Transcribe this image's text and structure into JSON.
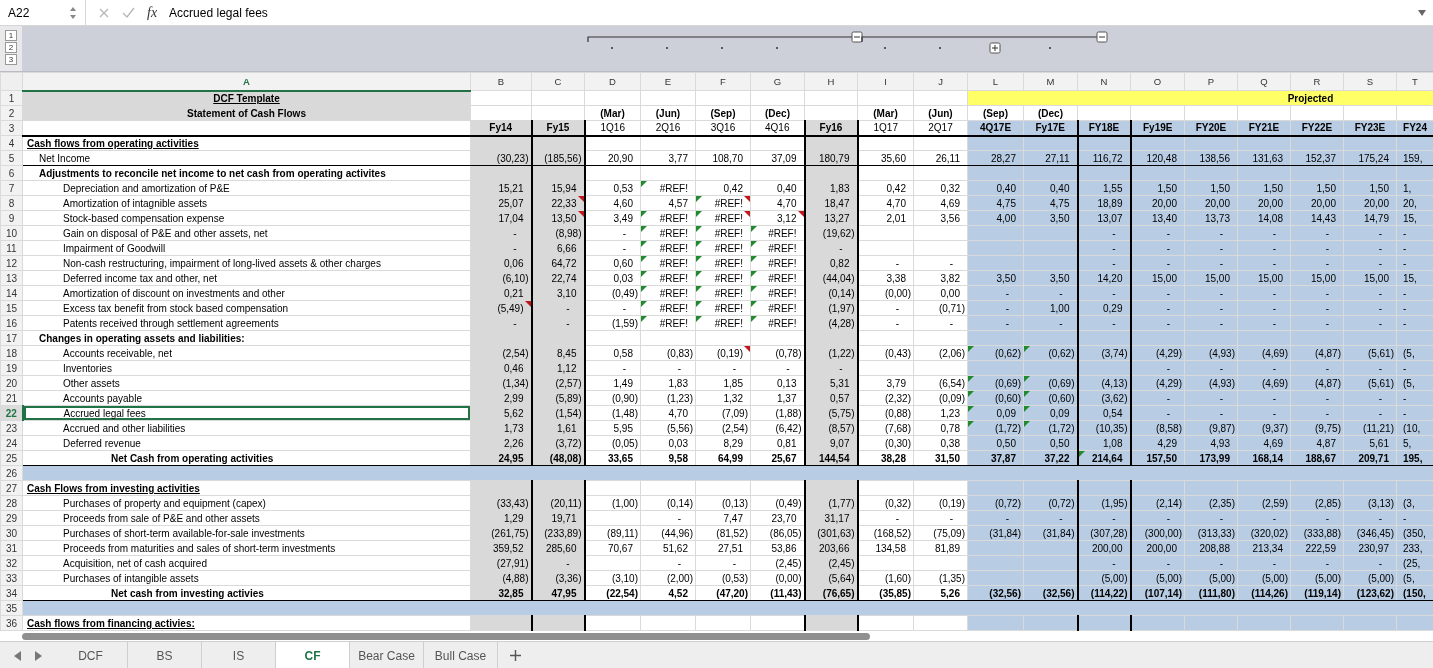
{
  "formula_bar": {
    "cell_ref": "A22",
    "function_label": "fx",
    "content": "Accrued legal fees"
  },
  "outline": {
    "levels": [
      "1",
      "2",
      "3"
    ],
    "groups": [
      {
        "expanded": true
      },
      {
        "expanded": true
      },
      {
        "expanded": false
      }
    ]
  },
  "columns": [
    {
      "letter": "A",
      "kind": "label",
      "selected": true
    },
    {
      "letter": "B",
      "kind": "actual",
      "selected": false
    },
    {
      "letter": "C",
      "kind": "actual",
      "selected": false
    },
    {
      "letter": "D",
      "kind": "quarter",
      "selected": false
    },
    {
      "letter": "E",
      "kind": "quarter",
      "selected": false
    },
    {
      "letter": "F",
      "kind": "quarter",
      "selected": false
    },
    {
      "letter": "G",
      "kind": "quarter",
      "selected": false
    },
    {
      "letter": "H",
      "kind": "actual",
      "selected": false
    },
    {
      "letter": "I",
      "kind": "quarter",
      "selected": false
    },
    {
      "letter": "J",
      "kind": "quarter",
      "selected": false
    },
    {
      "letter": "L",
      "kind": "projected",
      "selected": false
    },
    {
      "letter": "M",
      "kind": "projected",
      "selected": false
    },
    {
      "letter": "N",
      "kind": "projected",
      "selected": false
    },
    {
      "letter": "O",
      "kind": "projected",
      "selected": false
    },
    {
      "letter": "P",
      "kind": "projected",
      "selected": false
    },
    {
      "letter": "Q",
      "kind": "projected",
      "selected": false
    },
    {
      "letter": "R",
      "kind": "projected",
      "selected": false
    },
    {
      "letter": "S",
      "kind": "projected",
      "selected": false
    },
    {
      "letter": "T",
      "kind": "projected",
      "selected": false
    }
  ],
  "rows": [
    {
      "n": "1",
      "kind": "title",
      "label": "DCF Template",
      "selected": false,
      "banner": "Projected"
    },
    {
      "n": "2",
      "kind": "subtitle",
      "label": "Statement of Cash Flows",
      "selected": false,
      "cells": {
        "D": "(Mar)",
        "E": "(Jun)",
        "F": "(Sep)",
        "G": "(Dec)",
        "I": "(Mar)",
        "J": "(Jun)",
        "L": "(Sep)",
        "M": "(Dec)"
      },
      "bold": {
        "D": true,
        "E": true,
        "F": true,
        "G": true,
        "I": true,
        "J": true,
        "L": true,
        "M": true
      }
    },
    {
      "n": "3",
      "kind": "period",
      "selected": false,
      "cells": {
        "B": "Fy14",
        "C": "Fy15",
        "D": "1Q16",
        "E": "2Q16",
        "F": "3Q16",
        "G": "4Q16",
        "H": "Fy16",
        "I": "1Q17",
        "J": "2Q17",
        "L": "4Q17E",
        "M": "Fy17E",
        "N": "FY18E",
        "O": "Fy19E",
        "P": "FY20E",
        "Q": "FY21E",
        "R": "FY22E",
        "S": "FY23E",
        "T": "FY24"
      },
      "bold": {
        "B": true,
        "C": true,
        "H": true,
        "L": true,
        "M": true,
        "N": true,
        "O": true,
        "P": true,
        "Q": true,
        "R": true,
        "S": true,
        "T": true
      }
    },
    {
      "n": "4",
      "kind": "section",
      "label": "Cash flows from operating activities",
      "selected": false
    },
    {
      "n": "5",
      "kind": "item",
      "label": "Net Income",
      "selected": false,
      "cells": {
        "B": "(30,23)",
        "C": "(185,56)",
        "D": "20,90",
        "E": "3,77",
        "F": "108,70",
        "G": "37,09",
        "H": "180,79",
        "I": "35,60",
        "J": "26,11",
        "L": "28,27",
        "M": "27,11",
        "N": "116,72",
        "O": "120,48",
        "P": "138,56",
        "Q": "131,63",
        "R": "152,37",
        "S": "175,24",
        "T": "159,"
      }
    },
    {
      "n": "6",
      "kind": "heading",
      "label": "Adjustments to reconcile net income to net cash from operating activites",
      "selected": false
    },
    {
      "n": "7",
      "kind": "subitem",
      "label": "Depreciation and amortization of P&E",
      "selected": false,
      "cells": {
        "B": "15,21",
        "C": "15,94",
        "D": "0,53",
        "E": "#REF!",
        "F": "0,42",
        "G": "0,40",
        "H": "1,83",
        "I": "0,42",
        "J": "0,32",
        "L": "0,40",
        "M": "0,40",
        "N": "1,55",
        "O": "1,50",
        "P": "1,50",
        "Q": "1,50",
        "R": "1,50",
        "S": "1,50",
        "T": "1,"
      },
      "error_flags": {
        "E": true
      }
    },
    {
      "n": "8",
      "kind": "subitem",
      "label": "Amortization of intagnible assets",
      "selected": false,
      "cells": {
        "B": "25,07",
        "C": "22,33",
        "D": "4,60",
        "E": "4,57",
        "F": "#REF!",
        "G": "4,70",
        "H": "18,47",
        "I": "4,70",
        "J": "4,69",
        "L": "4,75",
        "M": "4,75",
        "N": "18,89",
        "O": "20,00",
        "P": "20,00",
        "Q": "20,00",
        "R": "20,00",
        "S": "20,00",
        "T": "20,"
      },
      "error_flags": {
        "F": true
      },
      "comment_flags": {
        "C": true,
        "F": true
      }
    },
    {
      "n": "9",
      "kind": "subitem",
      "label": "Stock-based compensation expense",
      "selected": false,
      "cells": {
        "B": "17,04",
        "C": "13,50",
        "D": "3,49",
        "E": "#REF!",
        "F": "#REF!",
        "G": "3,12",
        "H": "13,27",
        "I": "2,01",
        "J": "3,56",
        "L": "4,00",
        "M": "3,50",
        "N": "13,07",
        "O": "13,40",
        "P": "13,73",
        "Q": "14,08",
        "R": "14,43",
        "S": "14,79",
        "T": "15,"
      },
      "error_flags": {
        "E": true,
        "F": true
      },
      "comment_flags": {
        "C": true,
        "F": true,
        "G": true
      }
    },
    {
      "n": "10",
      "kind": "subitem",
      "label": "Gain on disposal of P&E and other assets, net",
      "selected": false,
      "cells": {
        "B": "-",
        "C": "(8,98)",
        "D": "-",
        "E": "#REF!",
        "F": "#REF!",
        "G": "#REF!",
        "H": "(19,62)",
        "N": "-",
        "O": "-",
        "P": "-",
        "Q": "-",
        "R": "-",
        "S": "-",
        "T": "-"
      },
      "error_flags": {
        "E": true,
        "F": true,
        "G": true
      }
    },
    {
      "n": "11",
      "kind": "subitem",
      "label": "Impairment of Goodwill",
      "selected": false,
      "cells": {
        "B": "-",
        "C": "6,66",
        "D": "-",
        "E": "#REF!",
        "F": "#REF!",
        "G": "#REF!",
        "H": "-",
        "N": "-",
        "O": "-",
        "P": "-",
        "Q": "-",
        "R": "-",
        "S": "-",
        "T": "-"
      },
      "error_flags": {
        "E": true,
        "F": true,
        "G": true
      }
    },
    {
      "n": "12",
      "kind": "subitem",
      "label": "Non-cash restructuring, impairment of long-lived assets & other charges",
      "selected": false,
      "cells": {
        "B": "0,06",
        "C": "64,72",
        "D": "0,60",
        "E": "#REF!",
        "F": "#REF!",
        "G": "#REF!",
        "H": "0,82",
        "I": "-",
        "J": "-",
        "N": "-",
        "O": "-",
        "P": "-",
        "Q": "-",
        "R": "-",
        "S": "-",
        "T": "-"
      },
      "error_flags": {
        "E": true,
        "F": true,
        "G": true
      }
    },
    {
      "n": "13",
      "kind": "subitem",
      "label": "Deferred income tax and other, net",
      "selected": false,
      "cells": {
        "B": "(6,10)",
        "C": "22,74",
        "D": "0,03",
        "E": "#REF!",
        "F": "#REF!",
        "G": "#REF!",
        "H": "(44,04)",
        "I": "3,38",
        "J": "3,82",
        "L": "3,50",
        "M": "3,50",
        "N": "14,20",
        "O": "15,00",
        "P": "15,00",
        "Q": "15,00",
        "R": "15,00",
        "S": "15,00",
        "T": "15,"
      },
      "error_flags": {
        "E": true,
        "F": true,
        "G": true
      }
    },
    {
      "n": "14",
      "kind": "subitem",
      "label": "Amortization of discount on investments and other",
      "selected": false,
      "cells": {
        "B": "0,21",
        "C": "3,10",
        "D": "(0,49)",
        "E": "#REF!",
        "F": "#REF!",
        "G": "#REF!",
        "H": "(0,14)",
        "I": "(0,00)",
        "J": "0,00",
        "L": "-",
        "M": "-",
        "N": "-",
        "O": "-",
        "P": "-",
        "Q": "-",
        "R": "-",
        "S": "-",
        "T": "-"
      },
      "error_flags": {
        "E": true,
        "F": true,
        "G": true
      }
    },
    {
      "n": "15",
      "kind": "subitem",
      "label": "Excess tax benefit from stock based compensation",
      "selected": false,
      "cells": {
        "B": "(5,49)",
        "C": "-",
        "D": "-",
        "E": "#REF!",
        "F": "#REF!",
        "G": "#REF!",
        "H": "(1,97)",
        "I": "-",
        "J": "(0,71)",
        "L": "-",
        "M": "1,00",
        "N": "0,29",
        "O": "-",
        "P": "-",
        "Q": "-",
        "R": "-",
        "S": "-",
        "T": "-"
      },
      "error_flags": {
        "E": true,
        "F": true,
        "G": true
      },
      "comment_flags": {
        "B": true
      }
    },
    {
      "n": "16",
      "kind": "subitem",
      "label": "Patents received through settlement agreements",
      "selected": false,
      "cells": {
        "B": "-",
        "C": "-",
        "D": "(1,59)",
        "E": "#REF!",
        "F": "#REF!",
        "G": "#REF!",
        "H": "(4,28)",
        "I": "-",
        "J": "-",
        "L": "-",
        "M": "-",
        "N": "-",
        "O": "-",
        "P": "-",
        "Q": "-",
        "R": "-",
        "S": "-",
        "T": "-"
      },
      "error_flags": {
        "E": true,
        "F": true,
        "G": true
      }
    },
    {
      "n": "17",
      "kind": "heading",
      "label": "Changes in operating assets and liabilities:",
      "selected": false
    },
    {
      "n": "18",
      "kind": "subitem",
      "label": "Accounts receivable, net",
      "selected": false,
      "cells": {
        "B": "(2,54)",
        "C": "8,45",
        "D": "0,58",
        "E": "(0,83)",
        "F": "(0,19)",
        "G": "(0,78)",
        "H": "(1,22)",
        "I": "(0,43)",
        "J": "(2,06)",
        "L": "(0,62)",
        "M": "(0,62)",
        "N": "(3,74)",
        "O": "(4,29)",
        "P": "(4,93)",
        "Q": "(4,69)",
        "R": "(4,87)",
        "S": "(5,61)",
        "T": "(5,"
      },
      "error_flags": {
        "L": true,
        "M": true
      },
      "comment_flags": {
        "F": true
      }
    },
    {
      "n": "19",
      "kind": "subitem",
      "label": "Inventories",
      "selected": false,
      "cells": {
        "B": "0,46",
        "C": "1,12",
        "D": "-",
        "E": "-",
        "F": "-",
        "G": "-",
        "H": "-",
        "O": "-",
        "P": "-",
        "Q": "-",
        "R": "-",
        "S": "-",
        "T": "-"
      }
    },
    {
      "n": "20",
      "kind": "subitem",
      "label": "Other assets",
      "selected": false,
      "cells": {
        "B": "(1,34)",
        "C": "(2,57)",
        "D": "1,49",
        "E": "1,83",
        "F": "1,85",
        "G": "0,13",
        "H": "5,31",
        "I": "3,79",
        "J": "(6,54)",
        "L": "(0,69)",
        "M": "(0,69)",
        "N": "(4,13)",
        "O": "(4,29)",
        "P": "(4,93)",
        "Q": "(4,69)",
        "R": "(4,87)",
        "S": "(5,61)",
        "T": "(5,"
      },
      "error_flags": {
        "L": true,
        "M": true
      }
    },
    {
      "n": "21",
      "kind": "subitem",
      "label": "Accounts payable",
      "selected": false,
      "cells": {
        "B": "2,99",
        "C": "(5,89)",
        "D": "(0,90)",
        "E": "(1,23)",
        "F": "1,32",
        "G": "1,37",
        "H": "0,57",
        "I": "(2,32)",
        "J": "(0,09)",
        "L": "(0,60)",
        "M": "(0,60)",
        "N": "(3,62)",
        "O": "-",
        "P": "-",
        "Q": "-",
        "R": "-",
        "S": "-",
        "T": "-"
      },
      "error_flags": {
        "L": true,
        "M": true
      }
    },
    {
      "n": "22",
      "kind": "subitem",
      "label": "Accrued legal fees",
      "selected": true,
      "cells": {
        "B": "5,62",
        "C": "(1,54)",
        "D": "(1,48)",
        "E": "4,70",
        "F": "(7,09)",
        "G": "(1,88)",
        "H": "(5,75)",
        "I": "(0,88)",
        "J": "1,23",
        "L": "0,09",
        "M": "0,09",
        "N": "0,54",
        "O": "-",
        "P": "-",
        "Q": "-",
        "R": "-",
        "S": "-",
        "T": "-"
      },
      "error_flags": {
        "L": true,
        "M": true
      }
    },
    {
      "n": "23",
      "kind": "subitem",
      "label": "Accrued and other liabilities",
      "selected": false,
      "cells": {
        "B": "1,73",
        "C": "1,61",
        "D": "5,95",
        "E": "(5,56)",
        "F": "(2,54)",
        "G": "(6,42)",
        "H": "(8,57)",
        "I": "(7,68)",
        "J": "0,78",
        "L": "(1,72)",
        "M": "(1,72)",
        "N": "(10,35)",
        "O": "(8,58)",
        "P": "(9,87)",
        "Q": "(9,37)",
        "R": "(9,75)",
        "S": "(11,21)",
        "T": "(10,"
      },
      "error_flags": {
        "L": true,
        "M": true
      }
    },
    {
      "n": "24",
      "kind": "subitem",
      "label": "Deferred revenue",
      "selected": false,
      "cells": {
        "B": "2,26",
        "C": "(3,72)",
        "D": "(0,05)",
        "E": "0,03",
        "F": "8,29",
        "G": "0,81",
        "H": "9,07",
        "I": "(0,30)",
        "J": "0,38",
        "L": "0,50",
        "M": "0,50",
        "N": "1,08",
        "O": "4,29",
        "P": "4,93",
        "Q": "4,69",
        "R": "4,87",
        "S": "5,61",
        "T": "5,"
      }
    },
    {
      "n": "25",
      "kind": "total",
      "label": "Net Cash from operating activities",
      "selected": false,
      "cells": {
        "B": "24,95",
        "C": "(48,08)",
        "D": "33,65",
        "E": "9,58",
        "F": "64,99",
        "G": "25,67",
        "H": "144,54",
        "I": "38,28",
        "J": "31,50",
        "L": "37,87",
        "M": "37,22",
        "N": "214,64",
        "O": "157,50",
        "P": "173,99",
        "Q": "168,14",
        "R": "188,67",
        "S": "209,71",
        "T": "195,"
      },
      "error_flags": {
        "N": true
      }
    },
    {
      "n": "26",
      "kind": "spacer",
      "selected": false
    },
    {
      "n": "27",
      "kind": "section",
      "label": "Cash Flows from investing activities",
      "selected": false
    },
    {
      "n": "28",
      "kind": "subitem",
      "label": "Purchases of property and equipment (capex)",
      "selected": false,
      "cells": {
        "B": "(33,43)",
        "C": "(20,11)",
        "D": "(1,00)",
        "E": "(0,14)",
        "F": "(0,13)",
        "G": "(0,49)",
        "H": "(1,77)",
        "I": "(0,32)",
        "J": "(0,19)",
        "L": "(0,72)",
        "M": "(0,72)",
        "N": "(1,95)",
        "O": "(2,14)",
        "P": "(2,35)",
        "Q": "(2,59)",
        "R": "(2,85)",
        "S": "(3,13)",
        "T": "(3,"
      }
    },
    {
      "n": "29",
      "kind": "subitem",
      "label": "Proceeds from sale of P&E and other assets",
      "selected": false,
      "cells": {
        "B": "1,29",
        "C": "19,71",
        "E": "-",
        "F": "7,47",
        "G": "23,70",
        "H": "31,17",
        "I": "-",
        "J": "-",
        "L": "-",
        "M": "-",
        "N": "-",
        "O": "-",
        "P": "-",
        "Q": "-",
        "R": "-",
        "S": "-",
        "T": "-"
      }
    },
    {
      "n": "30",
      "kind": "subitem",
      "label": "Purchases of short-term available-for-sale investments",
      "selected": false,
      "cells": {
        "B": "(261,75)",
        "C": "(233,89)",
        "D": "(89,11)",
        "E": "(44,96)",
        "F": "(81,52)",
        "G": "(86,05)",
        "H": "(301,63)",
        "I": "(168,52)",
        "J": "(75,09)",
        "L": "(31,84)",
        "M": "(31,84)",
        "N": "(307,28)",
        "O": "(300,00)",
        "P": "(313,33)",
        "Q": "(320,02)",
        "R": "(333,88)",
        "S": "(346,45)",
        "T": "(350,"
      }
    },
    {
      "n": "31",
      "kind": "subitem",
      "label": "Proceeds from maturities and sales of short-term investments",
      "selected": false,
      "cells": {
        "B": "359,52",
        "C": "285,60",
        "D": "70,67",
        "E": "51,62",
        "F": "27,51",
        "G": "53,86",
        "H": "203,66",
        "I": "134,58",
        "J": "81,89",
        "N": "200,00",
        "O": "200,00",
        "P": "208,88",
        "Q": "213,34",
        "R": "222,59",
        "S": "230,97",
        "T": "233,"
      }
    },
    {
      "n": "32",
      "kind": "subitem",
      "label": "Acquisition, net of cash acquired",
      "selected": false,
      "cells": {
        "B": "(27,91)",
        "C": "-",
        "E": "-",
        "F": "-",
        "G": "(2,45)",
        "H": "(2,45)",
        "N": "-",
        "O": "-",
        "P": "-",
        "Q": "-",
        "R": "-",
        "S": "-",
        "T": "(25,"
      }
    },
    {
      "n": "33",
      "kind": "subitem",
      "label": "Purchases of intangible assets",
      "selected": false,
      "cells": {
        "B": "(4,88)",
        "C": "(3,36)",
        "D": "(3,10)",
        "E": "(2,00)",
        "F": "(0,53)",
        "G": "(0,00)",
        "H": "(5,64)",
        "I": "(1,60)",
        "J": "(1,35)",
        "N": "(5,00)",
        "O": "(5,00)",
        "P": "(5,00)",
        "Q": "(5,00)",
        "R": "(5,00)",
        "S": "(5,00)",
        "T": "(5,"
      }
    },
    {
      "n": "34",
      "kind": "total",
      "label": "Net cash from investing activies",
      "selected": false,
      "cells": {
        "B": "32,85",
        "C": "47,95",
        "D": "(22,54)",
        "E": "4,52",
        "F": "(47,20)",
        "G": "(11,43)",
        "H": "(76,65)",
        "I": "(35,85)",
        "J": "5,26",
        "L": "(32,56)",
        "M": "(32,56)",
        "N": "(114,22)",
        "O": "(107,14)",
        "P": "(111,80)",
        "Q": "(114,26)",
        "R": "(119,14)",
        "S": "(123,62)",
        "T": "(150,"
      }
    },
    {
      "n": "35",
      "kind": "spacer",
      "selected": false
    },
    {
      "n": "36",
      "kind": "section",
      "label": "Cash flows from financing activies:",
      "selected": false
    }
  ],
  "sheet_tabs": [
    {
      "label": "DCF",
      "selected": false
    },
    {
      "label": "BS",
      "selected": false
    },
    {
      "label": "IS",
      "selected": false
    },
    {
      "label": "CF",
      "selected": true
    },
    {
      "label": "Bear Case",
      "selected": false
    },
    {
      "label": "Bull Case",
      "selected": false
    }
  ]
}
